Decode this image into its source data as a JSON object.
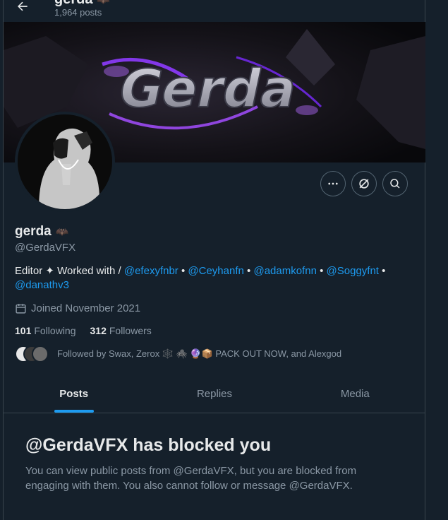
{
  "header": {
    "name": "gerda",
    "name_emoji": "🦇",
    "post_count": "1,964 posts"
  },
  "banner": {
    "text": "Gerda"
  },
  "profile": {
    "display_name": "gerda",
    "name_emoji": "🦇",
    "handle": "@GerdaVFX",
    "bio_prefix": "Editor ✦ Worked with /",
    "bio_links": [
      "@efexyfnbr",
      "@Ceyhanfn",
      "@adamkofnn",
      "@Soggyfnt",
      "@danathv3"
    ],
    "bio_separator": "•",
    "joined": "Joined November 2021",
    "following_count": "101",
    "following_label": "Following",
    "followers_count": "312",
    "followers_label": "Followers",
    "followed_by": "Followed by Swax, Zerox 🕸️ 🕷️ 🔮📦 PACK OUT NOW, and Alexgod"
  },
  "tabs": [
    "Posts",
    "Replies",
    "Media"
  ],
  "active_tab": "Posts",
  "blocked": {
    "title": "@GerdaVFX has blocked you",
    "message": "You can view public posts from @GerdaVFX, but you are blocked from engaging with them. You also cannot follow or message @GerdaVFX."
  },
  "colors": {
    "background": "#15202b",
    "accent": "#1d9bf0",
    "secondary_text": "#8b98a5",
    "border": "#38444d"
  },
  "icons": [
    "back-arrow-icon",
    "more-icon",
    "grok-icon",
    "search-icon",
    "calendar-icon"
  ]
}
